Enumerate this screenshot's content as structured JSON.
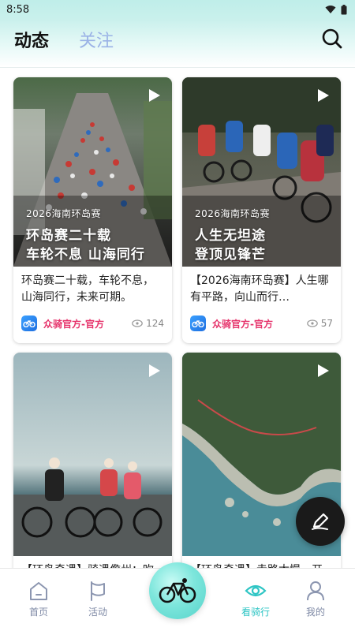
{
  "status_bar": {
    "time": "8:58"
  },
  "header": {
    "tabs": [
      {
        "label": "动态",
        "active": true
      },
      {
        "label": "关注",
        "active": false
      }
    ],
    "search_icon": "search-icon"
  },
  "feed": {
    "cards": [
      {
        "overlay_sub": "2026海南环岛赛",
        "overlay_line1": "环岛赛二十载",
        "overlay_line2": "车轮不息 山海同行",
        "title": "环岛赛二十载，车轮不息，山海同行，未来可期。",
        "author": "众骑官方-官方",
        "views": "124",
        "type": "video"
      },
      {
        "overlay_sub": "2026海南环岛赛",
        "overlay_line1": "人生无坦途",
        "overlay_line2": "登顶见锋芒",
        "title": "【2026海南环岛赛】人生哪有平路，向山而行…",
        "author": "众骑官方-官方",
        "views": "57",
        "type": "video"
      },
      {
        "title": "【环岛奇遇】骑遇儋州：吹",
        "type": "video"
      },
      {
        "title": "【环岛奇遇】走路太慢，开",
        "type": "video"
      }
    ]
  },
  "fab": {
    "icon": "edit-pen-icon"
  },
  "bottom_nav": {
    "items": [
      {
        "label": "首页",
        "icon": "home-icon",
        "active": false
      },
      {
        "label": "活动",
        "icon": "flag-icon",
        "active": false
      },
      {
        "label": "看骑行",
        "icon": "eye-icon",
        "active": true
      },
      {
        "label": "我的",
        "icon": "person-icon",
        "active": false
      }
    ],
    "center_icon": "bicycle-icon"
  },
  "colors": {
    "accent": "#2ec5c4",
    "author": "#e6336b",
    "inactive_tab": "#9ab2e6",
    "header_bg": "#c9f0ec"
  }
}
